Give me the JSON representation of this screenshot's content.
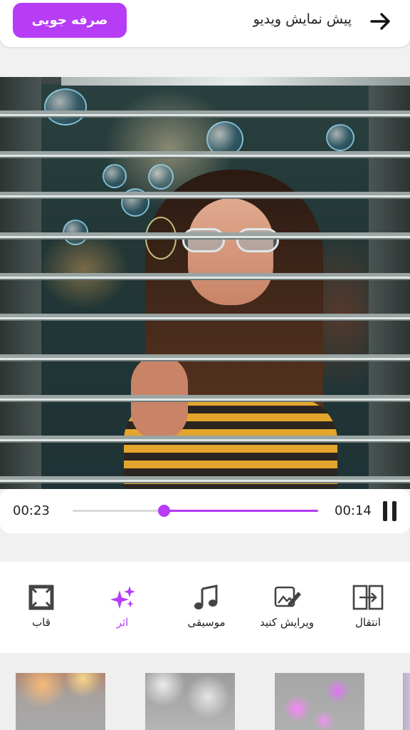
{
  "header": {
    "title": "پیش نمایش ویدیو",
    "save_label": "صرفه جویی"
  },
  "player": {
    "current_time": "00:14",
    "total_time": "00:23",
    "progress": 0.37
  },
  "tools": [
    {
      "label": "انتقال",
      "icon": "transition-icon"
    },
    {
      "label": "ویرایش کنید",
      "icon": "edit-image-icon"
    },
    {
      "label": "موسیقی",
      "icon": "music-note-icon"
    },
    {
      "label": "اثر",
      "icon": "sparkles-icon",
      "active": true
    },
    {
      "label": "قاب",
      "icon": "frame-icon"
    }
  ],
  "colors": {
    "accent": "#b63cf5",
    "text": "#222222"
  }
}
